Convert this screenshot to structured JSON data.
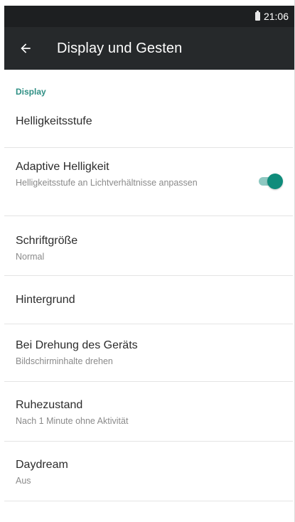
{
  "status_bar": {
    "time": "21:06",
    "battery_icon": "battery-icon"
  },
  "app_bar": {
    "back_icon": "arrow-left-icon",
    "title": "Display und Gesten",
    "background": "#26292b"
  },
  "section": {
    "header": "Display",
    "accent_color": "#2f8f84"
  },
  "items": [
    {
      "title": "Helligkeitsstufe"
    },
    {
      "title": "Adaptive Helligkeit",
      "summary": "Helligkeitsstufe an Lichtverhältnisse anpassen",
      "toggle_on": true
    },
    {
      "title": "Schriftgröße",
      "summary": "Normal"
    },
    {
      "title": "Hintergrund"
    },
    {
      "title": "Bei Drehung des Geräts",
      "summary": "Bildschirminhalte drehen"
    },
    {
      "title": "Ruhezustand",
      "summary": "Nach 1 Minute ohne Aktivität"
    },
    {
      "title": "Daydream",
      "summary": "Aus"
    }
  ]
}
